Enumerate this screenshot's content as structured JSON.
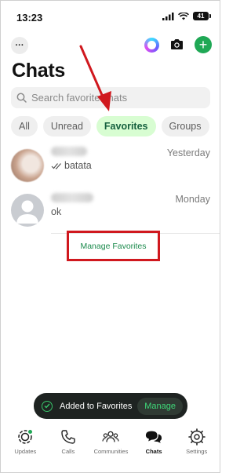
{
  "status_bar": {
    "time": "13:23",
    "battery": "41"
  },
  "header": {
    "title": "Chats"
  },
  "search": {
    "placeholder": "Search favorite chats"
  },
  "filters": [
    {
      "label": "All",
      "active": false
    },
    {
      "label": "Unread",
      "active": false
    },
    {
      "label": "Favorites",
      "active": true
    },
    {
      "label": "Groups",
      "active": false
    }
  ],
  "chats": [
    {
      "time": "Yesterday",
      "preview": "batata",
      "read_receipt": true
    },
    {
      "time": "Monday",
      "preview": "ok",
      "read_receipt": false
    }
  ],
  "manage_favorites_label": "Manage Favorites",
  "toast": {
    "message": "Added to Favorites",
    "action": "Manage"
  },
  "tabs": [
    {
      "label": "Updates",
      "icon": "updates-icon"
    },
    {
      "label": "Calls",
      "icon": "phone-icon"
    },
    {
      "label": "Communities",
      "icon": "communities-icon"
    },
    {
      "label": "Chats",
      "icon": "chats-icon",
      "active": true
    },
    {
      "label": "Settings",
      "icon": "gear-icon"
    }
  ],
  "colors": {
    "accent_green": "#1fa855",
    "active_chip_bg": "#d8fdd2",
    "annotation_red": "#d0181e"
  }
}
